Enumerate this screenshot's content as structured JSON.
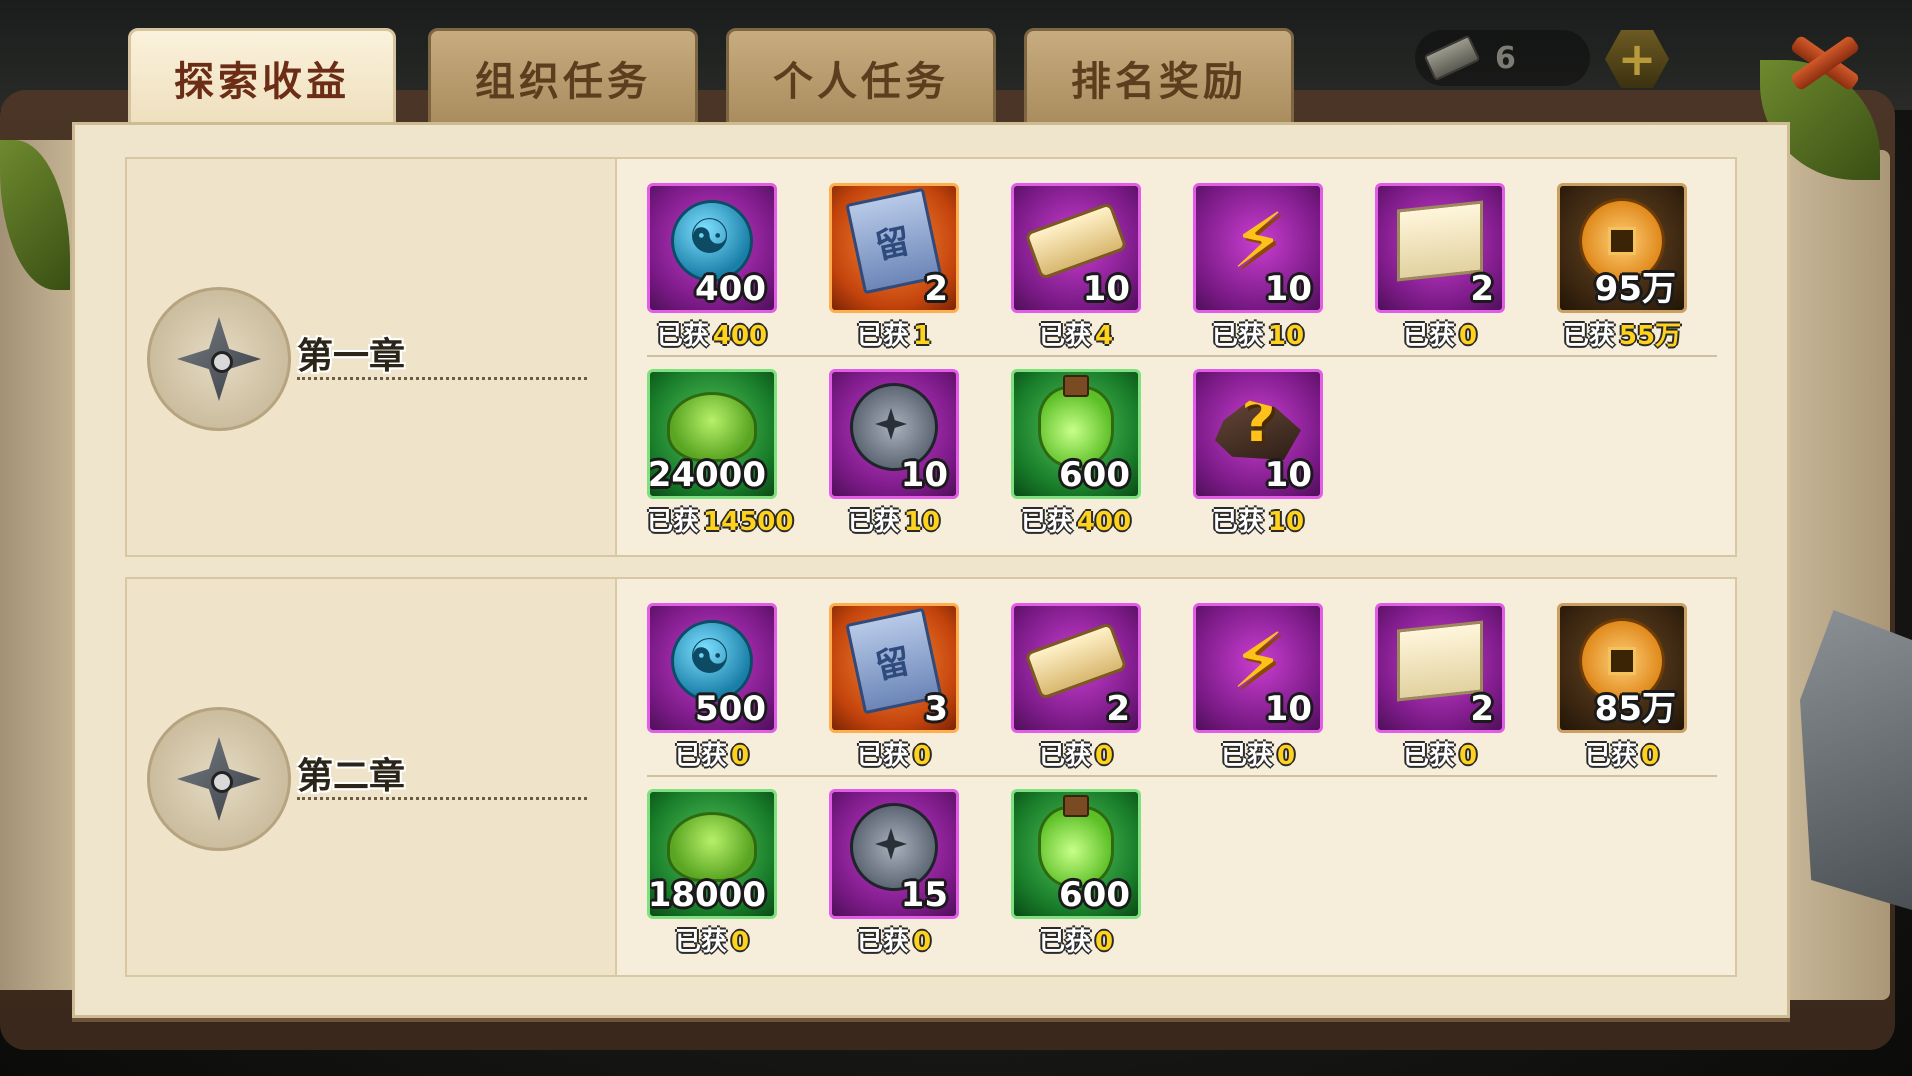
{
  "tabs": [
    {
      "label": "探索收益",
      "active": true
    },
    {
      "label": "组织任务",
      "active": false
    },
    {
      "label": "个人任务",
      "active": false
    },
    {
      "label": "排名奖励",
      "active": false
    }
  ],
  "header": {
    "currency_value": "6",
    "add_symbol": "+",
    "currency_icon": "ticket-icon",
    "close_icon": "close-icon"
  },
  "colors": {
    "purple_frame": "#e35ce8",
    "orange_frame": "#ffae4d",
    "green_frame": "#7fe07f",
    "gold_frame": "#c9a061",
    "obtained_value": "#ffd21e"
  },
  "obtained_label": "已获",
  "chapters": [
    {
      "title": "第一章",
      "icon": "shuriken-icon",
      "items": [
        {
          "icon": "yinyang-orb-icon",
          "frame": "purple",
          "qty": "400",
          "obtained": "400"
        },
        {
          "icon": "stay-ticket-icon",
          "frame": "orange",
          "qty": "2",
          "obtained": "1"
        },
        {
          "icon": "scroll-ticket-icon",
          "frame": "purple",
          "qty": "10",
          "obtained": "4"
        },
        {
          "icon": "lightning-icon",
          "frame": "purple",
          "qty": "10",
          "obtained": "10"
        },
        {
          "icon": "map-scroll-icon",
          "frame": "purple",
          "qty": "2",
          "obtained": "0"
        },
        {
          "icon": "copper-coin-icon",
          "frame": "brown",
          "qty": "95万",
          "obtained": "55万"
        },
        {
          "icon": "toad-icon",
          "frame": "green",
          "qty": "24000",
          "obtained": "14500"
        },
        {
          "icon": "shuriken-disc-icon",
          "frame": "purple",
          "qty": "10",
          "obtained": "10"
        },
        {
          "icon": "green-potion-icon",
          "frame": "green",
          "qty": "600",
          "obtained": "400"
        },
        {
          "icon": "mystery-stone-icon",
          "frame": "purple",
          "qty": "10",
          "obtained": "10"
        }
      ]
    },
    {
      "title": "第二章",
      "icon": "shuriken-icon",
      "items": [
        {
          "icon": "yinyang-orb-icon",
          "frame": "purple",
          "qty": "500",
          "obtained": "0"
        },
        {
          "icon": "stay-ticket-icon",
          "frame": "orange",
          "qty": "3",
          "obtained": "0"
        },
        {
          "icon": "scroll-ticket-icon",
          "frame": "purple",
          "qty": "2",
          "obtained": "0"
        },
        {
          "icon": "lightning-icon",
          "frame": "purple",
          "qty": "10",
          "obtained": "0"
        },
        {
          "icon": "map-scroll-icon",
          "frame": "purple",
          "qty": "2",
          "obtained": "0"
        },
        {
          "icon": "copper-coin-icon",
          "frame": "brown",
          "qty": "85万",
          "obtained": "0"
        },
        {
          "icon": "toad-icon",
          "frame": "green",
          "qty": "18000",
          "obtained": "0"
        },
        {
          "icon": "shuriken-disc-icon",
          "frame": "purple",
          "qty": "15",
          "obtained": "0"
        },
        {
          "icon": "green-potion-icon",
          "frame": "green",
          "qty": "600",
          "obtained": "0"
        }
      ]
    }
  ]
}
